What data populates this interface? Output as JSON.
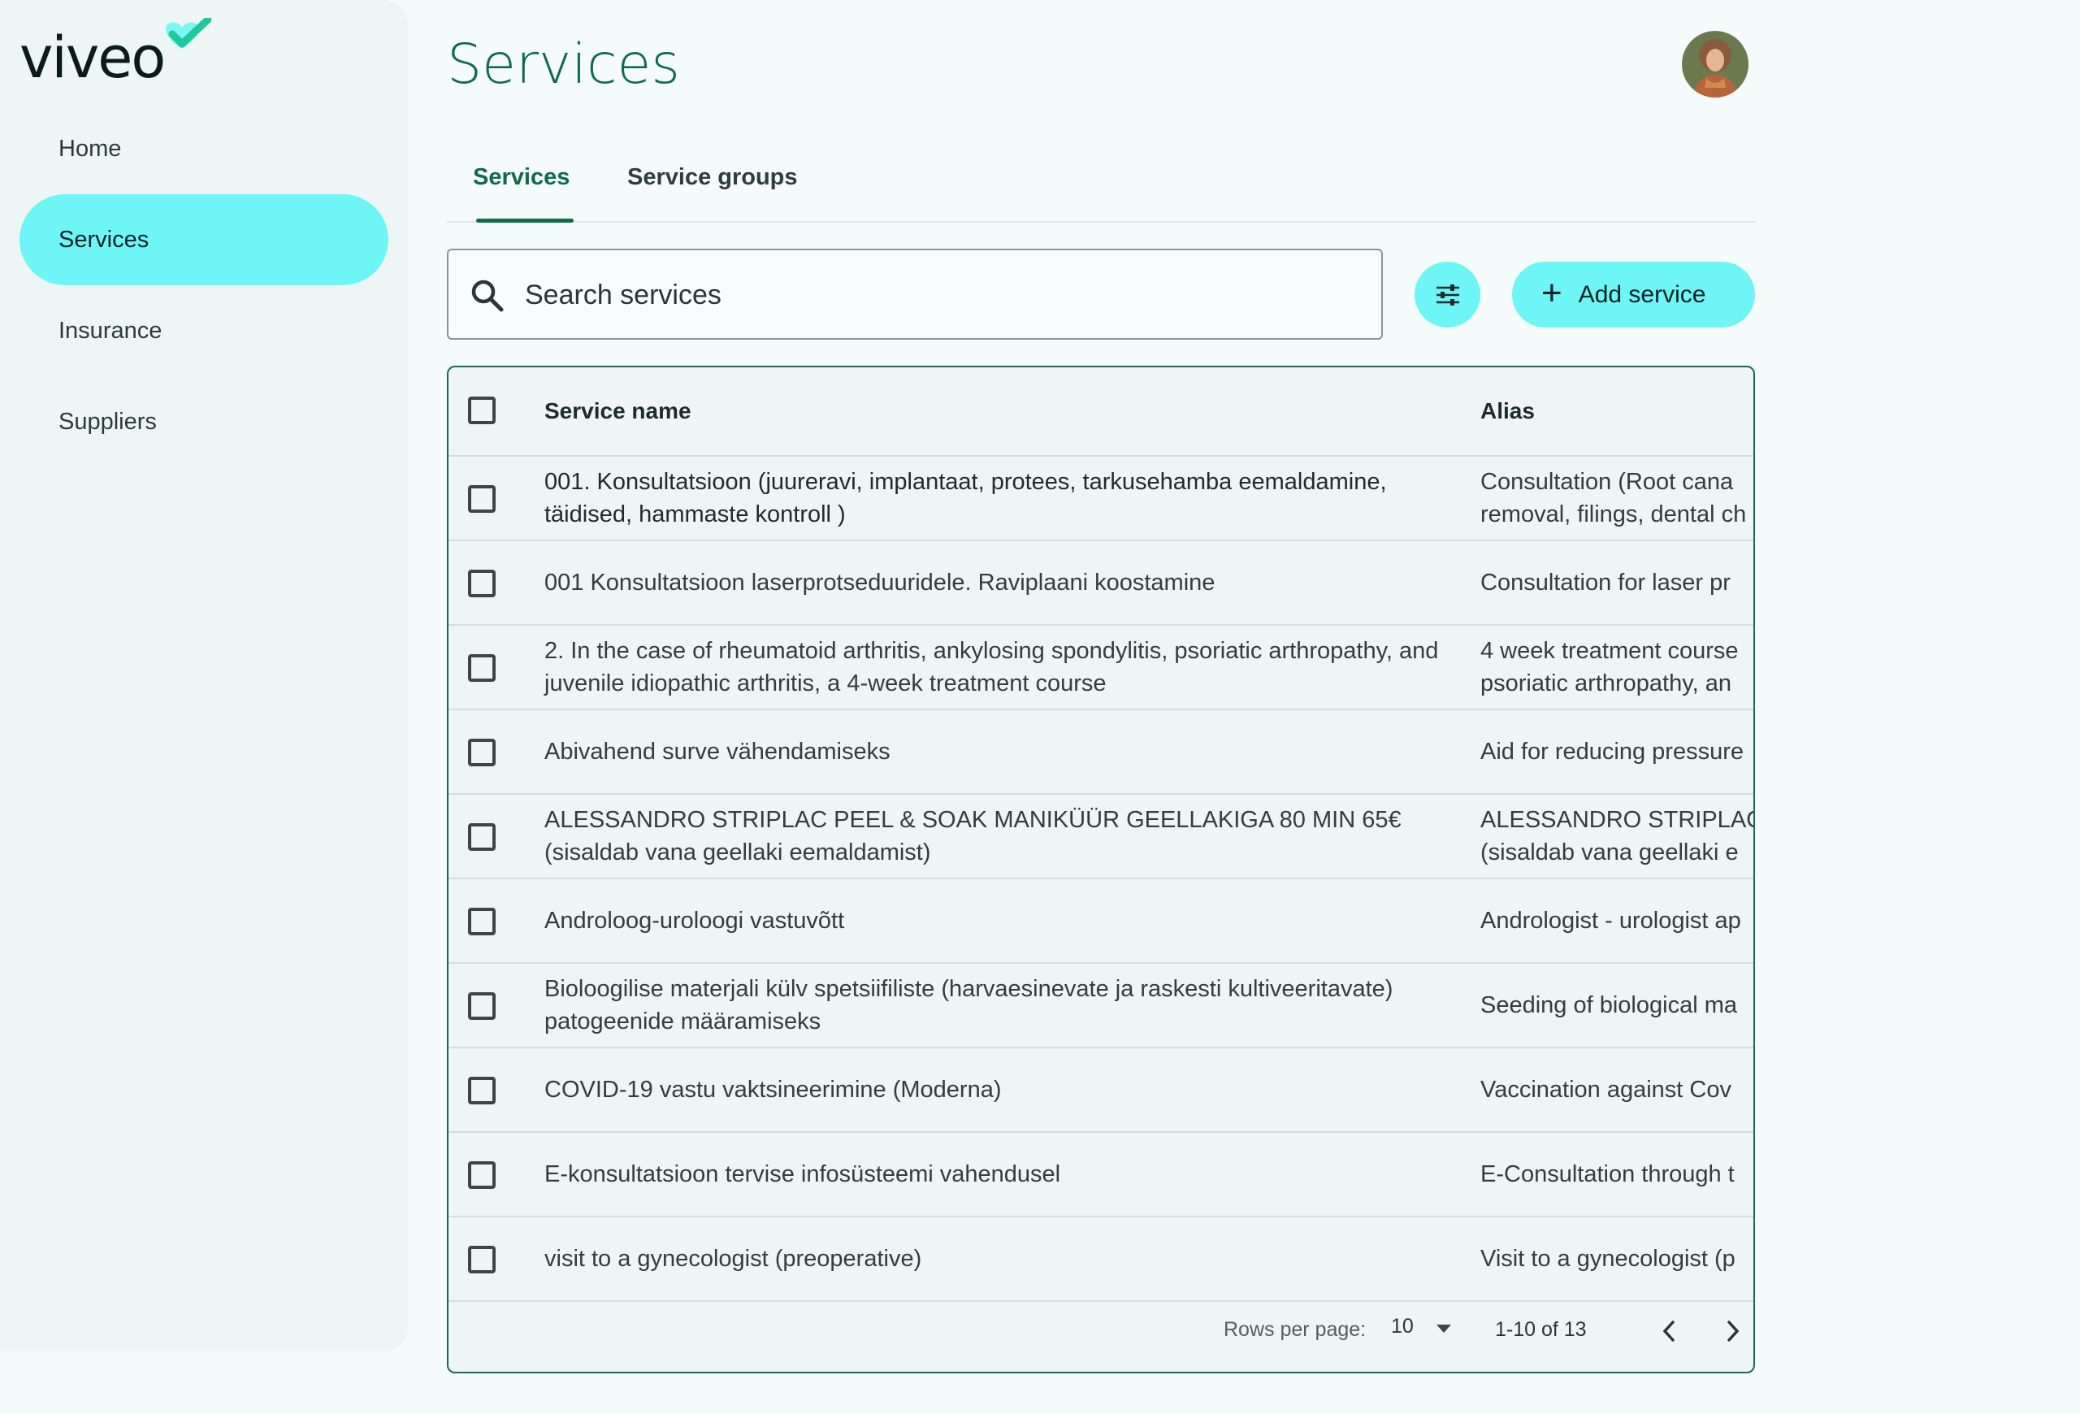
{
  "brand": {
    "logo_text": "viveo",
    "accent": "#6ef5f5",
    "primary": "#0f6b4a"
  },
  "sidebar": {
    "items": [
      {
        "label": "Home"
      },
      {
        "label": "Services",
        "active": true
      },
      {
        "label": "Insurance"
      },
      {
        "label": "Suppliers"
      }
    ]
  },
  "header": {
    "title": "Services"
  },
  "tabs": [
    {
      "label": "Services",
      "active": true
    },
    {
      "label": "Service groups"
    }
  ],
  "search": {
    "placeholder": "Search services",
    "value": ""
  },
  "toolbar": {
    "filter_icon": "filter-icon",
    "add_label": "Add service"
  },
  "table": {
    "headers": {
      "name": "Service name",
      "alias": "Alias"
    },
    "rows": [
      {
        "name": "001. Konsultatsioon (juureravi, implantaat, protees, tarkusehamba eemaldamine, täidised, hammaste kontroll )",
        "alias": "Consultation (Root cana\nremoval, filings, dental ch"
      },
      {
        "name": "001 Konsultatsioon laserprotseduuridele. Raviplaani koostamine",
        "alias": "Consultation for laser pr"
      },
      {
        "name": "2. In the case of rheumatoid arthritis, ankylosing spondylitis, psoriatic arthropathy, and juvenile idiopathic arthritis, a 4-week treatment course",
        "alias": "4 week treatment course\npsoriatic arthropathy, an"
      },
      {
        "name": "Abivahend surve vähendamiseks",
        "alias": "Aid for reducing pressure"
      },
      {
        "name": "ALESSANDRO STRIPLAC PEEL & SOAK MANIKÜÜR GEELLAKIGA 80 MIN 65€ (sisaldab vana geellaki eemaldamist)",
        "alias": "ALESSANDRO STRIPLAC\n(sisaldab vana geellaki e"
      },
      {
        "name": "Androloog-uroloogi vastuvõtt",
        "alias": "Andrologist - urologist ap"
      },
      {
        "name": "Bioloogilise materjali külv spetsiifiliste (harvaesinevate ja raskesti kultiveeritavate) patogeenide määramiseks",
        "alias": "Seeding of biological ma"
      },
      {
        "name": "COVID-19 vastu vaktsineerimine (Moderna)",
        "alias": "Vaccination against Cov"
      },
      {
        "name": "E-konsultatsioon tervise infosüsteemi vahendusel",
        "alias": "E-Consultation through t"
      },
      {
        "name": "visit to a gynecologist (preoperative)",
        "alias": "Visit to a gynecologist (p"
      }
    ]
  },
  "pagination": {
    "rows_per_page_label": "Rows per page:",
    "rows_per_page_value": "10",
    "range": "1-10 of 13"
  }
}
